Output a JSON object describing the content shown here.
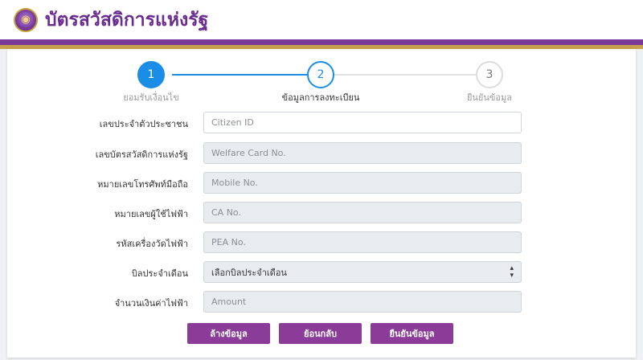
{
  "app": {
    "title": "บัตรสวัสดิการแห่งรัฐ"
  },
  "stepper": [
    {
      "number": "1",
      "label": "ยอมรับเงื่อนไข",
      "state": "done"
    },
    {
      "number": "2",
      "label": "ข้อมูลการลงทะเบียน",
      "state": "active"
    },
    {
      "number": "3",
      "label": "ยืนยันข้อมูล",
      "state": "pending"
    }
  ],
  "form": {
    "citizen_id": {
      "label": "เลขประจำตัวประชาชน",
      "placeholder": "Citizen ID",
      "value": ""
    },
    "welfare_card": {
      "label": "เลขบัตรสวัสดิการแห่งรัฐ",
      "placeholder": "Welfare Card No.",
      "value": ""
    },
    "mobile": {
      "label": "หมายเลขโทรศัพท์มือถือ",
      "placeholder": "Mobile No.",
      "value": ""
    },
    "ca_no": {
      "label": "หมายเลขผู้ใช้ไฟฟ้า",
      "placeholder": "CA No.",
      "value": ""
    },
    "pea_no": {
      "label": "รหัสเครื่องวัดไฟฟ้า",
      "placeholder": "PEA No.",
      "value": ""
    },
    "monthly_bill": {
      "label": "บิลประจำเดือน",
      "selected": "เลือกบิลประจำเดือน"
    },
    "amount": {
      "label": "จำนวนเงินค่าไฟฟ้า",
      "placeholder": "Amount",
      "value": ""
    }
  },
  "buttons": {
    "clear": "ล้างข้อมูล",
    "back": "ย้อนกลับ",
    "confirm": "ยืนยันข้อมูล"
  },
  "colors": {
    "brand_purple": "#7a3a9a",
    "brand_gold": "#c6a04d",
    "step_blue": "#1a8ee6",
    "button_purple": "#8a3c98"
  }
}
